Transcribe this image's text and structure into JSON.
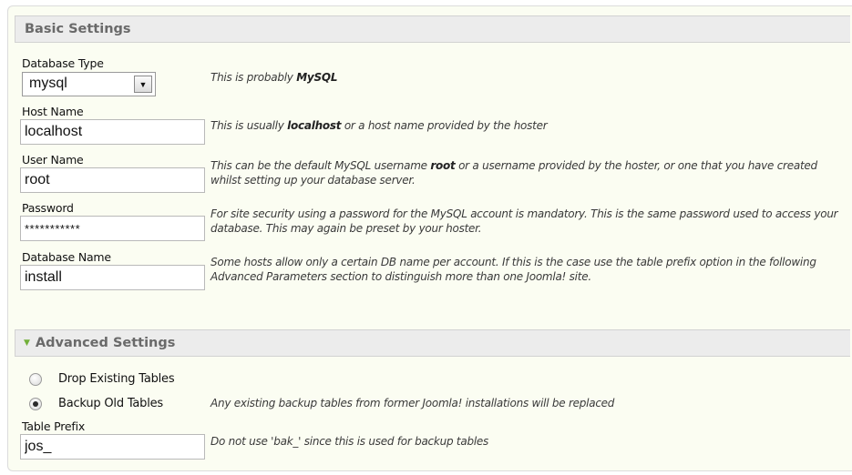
{
  "basic": {
    "header": "Basic Settings",
    "db_type": {
      "label": "Database Type",
      "value": "mysql",
      "help_pre": "This is probably ",
      "help_bold": "MySQL",
      "help_post": ""
    },
    "host": {
      "label": "Host Name",
      "value": "localhost",
      "help_pre": "This is usually ",
      "help_bold": "localhost",
      "help_post": " or a host name provided by the hoster"
    },
    "user": {
      "label": "User Name",
      "value": "root",
      "help_pre": "This can be the default MySQL username ",
      "help_bold": "root",
      "help_post": " or a username provided by the hoster, or one that you have created whilst setting up your database server."
    },
    "password": {
      "label": "Password",
      "value": "***********",
      "help": "For site security using a password for the MySQL account is mandatory. This is the same password used to access your database. This may again be preset by your hoster."
    },
    "db_name": {
      "label": "Database Name",
      "value": "install",
      "help": "Some hosts allow only a certain DB name per account. If this is the case use the table prefix option in the following Advanced Parameters section to distinguish more than one Joomla! site."
    }
  },
  "advanced": {
    "header": "Advanced Settings",
    "drop_label": "Drop Existing Tables",
    "backup_label": "Backup Old Tables",
    "backup_help": "Any existing backup tables from former Joomla! installations will be replaced",
    "selected": "backup",
    "prefix": {
      "label": "Table Prefix",
      "value": "jos_",
      "help": "Do not use 'bak_' since this is used for backup tables"
    }
  },
  "icons": {
    "expand": "triangle-down-icon",
    "dropdown": "chevron-down-icon"
  },
  "colors": {
    "panel_bg": "#fbfdf2",
    "header_bg": "#ececec",
    "header_text": "#6a6a6a",
    "arrow": "#72b03a"
  }
}
